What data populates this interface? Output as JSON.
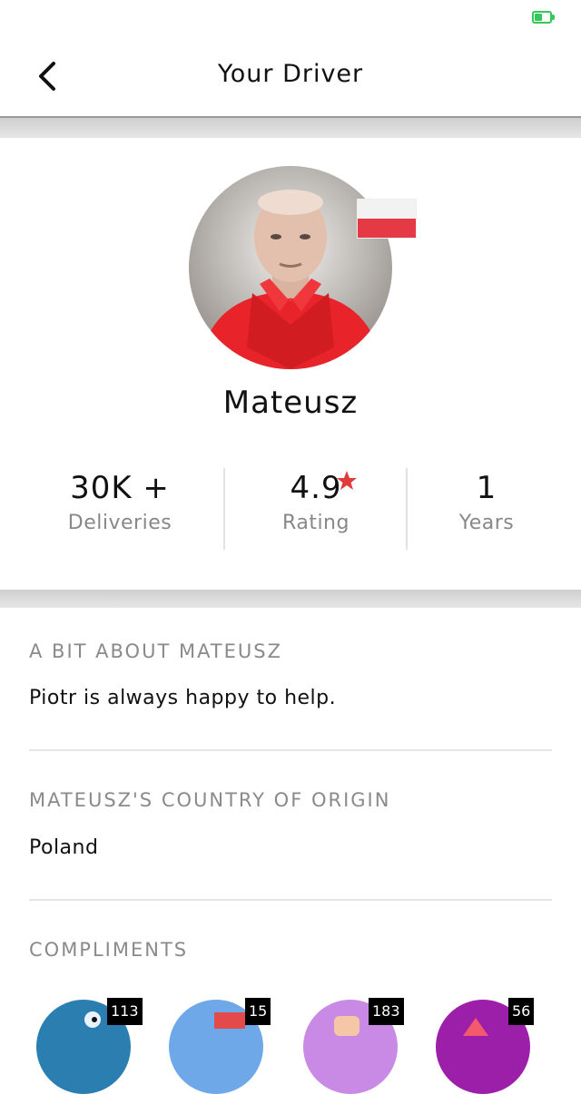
{
  "status_bar": {
    "battery_color": "#34c759"
  },
  "nav": {
    "title": "Your Driver",
    "back_icon": "chevron-left-icon"
  },
  "driver": {
    "name": "Mateusz",
    "flag": "poland-flag-icon"
  },
  "stats": [
    {
      "value": "30K +",
      "label": "Deliveries"
    },
    {
      "value": "4.9",
      "label": "Rating",
      "icon": "star-icon",
      "icon_color": "#e03a3a"
    },
    {
      "value": "1",
      "label": "Years"
    }
  ],
  "about": {
    "title": "A BIT ABOUT MATEUSZ",
    "text": "Piotr is always happy to help."
  },
  "origin": {
    "title": "MATEUSZ'S COUNTRY OF ORIGIN",
    "text": "Poland"
  },
  "compliments": {
    "title": "COMPLIMENTS",
    "items": [
      {
        "count": "113",
        "color": "#2a7fb0"
      },
      {
        "count": "15",
        "color": "#6fa8e8"
      },
      {
        "count": "183",
        "color": "#c98ae6"
      },
      {
        "count": "56",
        "color": "#9b1fa8"
      }
    ]
  }
}
